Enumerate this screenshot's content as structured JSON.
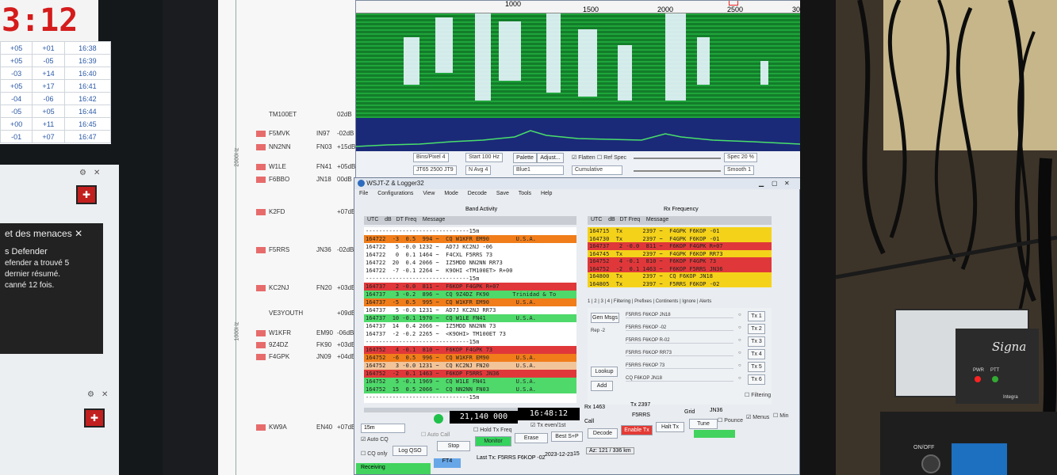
{
  "left_screen": {
    "clock": "3:12",
    "table": [
      [
        "+05",
        "+01",
        "16:38"
      ],
      [
        "+05",
        "-05",
        "16:39"
      ],
      [
        "-03",
        "+14",
        "16:40"
      ],
      [
        "+05",
        "+17",
        "16:41"
      ],
      [
        "-04",
        "-06",
        "16:42"
      ],
      [
        "-05",
        "+05",
        "16:44"
      ],
      [
        "+00",
        "+11",
        "16:45"
      ],
      [
        "-01",
        "+07",
        "16:47"
      ]
    ],
    "toast_title": "et des menaces",
    "toast_close": "✕",
    "toast_app": "s Defender",
    "toast_line1": "efender a trouvé 5",
    "toast_line2": "dernier résumé.",
    "toast_line3": "canné 12 fois."
  },
  "spots": [
    {
      "call": "TM100ET",
      "loc": "",
      "rpt": "02dB",
      "box": false
    },
    {
      "call": "F5MVK",
      "loc": "IN97",
      "rpt": "-02dB",
      "box": true
    },
    {
      "call": "NN2NN",
      "loc": "FN03",
      "rpt": "+15dB",
      "box": true
    },
    {
      "call": "W1LE",
      "loc": "FN41",
      "rpt": "+05dB",
      "box": true
    },
    {
      "call": "F6BBO",
      "loc": "JN18",
      "rpt": "00dB",
      "box": true
    },
    {
      "call": "K2FD",
      "loc": "",
      "rpt": "+07dB",
      "box": true
    },
    {
      "call": "F5RRS",
      "loc": "JN36",
      "rpt": "-02dB",
      "box": true
    },
    {
      "call": "KC2NJ",
      "loc": "FN20",
      "rpt": "+03dB",
      "box": true
    },
    {
      "call": "VE3YOUTH",
      "loc": "",
      "rpt": "+09dB",
      "box": false
    },
    {
      "call": "W1KFR",
      "loc": "EM90",
      "rpt": "-06dB",
      "box": true
    },
    {
      "call": "9Z4DZ",
      "loc": "FK90",
      "rpt": "+03dB",
      "box": true
    },
    {
      "call": "F4GPK",
      "loc": "JN09",
      "rpt": "+04dB",
      "box": true
    },
    {
      "call": "KW9A",
      "loc": "EN40",
      "rpt": "+07dB",
      "box": true
    }
  ],
  "axis_labels": {
    "hz2000": "2000Hz",
    "hz1000": "1000Hz"
  },
  "waterfall": {
    "scale": [
      "1000",
      "1500",
      "2000",
      "2500",
      "3000"
    ],
    "bins_pixel": "Bins/Pixel  4",
    "start": "Start 100 Hz",
    "palette": "Palette",
    "adjust": "Adjust...",
    "flatten": "Flatten",
    "ref_spec": "Ref Spec",
    "jt65": "JT65  2500  JT9",
    "navg": "N Avg  4",
    "blue": "Blue1",
    "cumulative": "Cumulative",
    "spec": "Spec  20 %",
    "smooth": "Smooth  1"
  },
  "main": {
    "title": "WSJT-Z & Logger32",
    "menu": [
      "File",
      "Configurations",
      "View",
      "Mode",
      "Decode",
      "Save",
      "Tools",
      "Help"
    ],
    "band_activity": "Band Activity",
    "rx_frequency": "Rx Frequency",
    "hdr_left": "UTC    dB   DT Freq    Message",
    "hdr_right": "UTC    dB   DT Freq    Message",
    "band_rows": [
      {
        "t": "-------------------------------15m",
        "c": "#ffffff"
      },
      {
        "t": "164722  -3  0.5  994 ~  CQ W1KFR EM90        U.S.A.",
        "c": "#f07d1a"
      },
      {
        "t": "164722   5 -0.0 1232 ~  AD7J KC2NJ -06",
        "c": "#ffffff"
      },
      {
        "t": "164722   0  0.1 1464 ~  F4CXL F5RRS 73",
        "c": "#ffffff"
      },
      {
        "t": "164722  20  0.4 2066 ~  IZ5MDD NN2NN RR73",
        "c": "#ffffff"
      },
      {
        "t": "164722  -7 -0.1 2264 ~  K9OHI <TM100ET> R+00",
        "c": "#ffffff"
      },
      {
        "t": "-------------------------------15m",
        "c": "#ffffff"
      },
      {
        "t": "164737   2 -0.0  811 ~  F6KOP F4GPK R+07",
        "c": "#e0383a"
      },
      {
        "t": "164737   3 -0.2  896 ~  CQ 9Z4DZ FK90       Trinidad & To",
        "c": "#4ed96a"
      },
      {
        "t": "164737  -5  0.5  995 ~  CQ W1KFR EM90        U.S.A.",
        "c": "#f07d1a"
      },
      {
        "t": "164737   5 -0.0 1231 ~  AD7J KC2NJ RR73",
        "c": "#ffffff"
      },
      {
        "t": "164737  10 -0.1 1970 ~  CQ W1LE FN41         U.S.A.",
        "c": "#4ed96a"
      },
      {
        "t": "164737  14  0.4 2066 ~  IZ5MDD NN2NN 73",
        "c": "#ffffff"
      },
      {
        "t": "164737  -2 -0.2 2265 ~  <K9OHI> TM100ET 73",
        "c": "#ffffff"
      },
      {
        "t": "-------------------------------15m",
        "c": "#ffffff"
      },
      {
        "t": "164752   4 -0.1  810 ~  F6KOP F4GPK 73",
        "c": "#e0383a"
      },
      {
        "t": "164752  -6  0.5  996 ~  CQ W1KFR EM90        U.S.A.",
        "c": "#f07d1a"
      },
      {
        "t": "164752   3 -0.0 1231 ~  CQ KC2NJ FN20        U.S.A.",
        "c": "#f2c49a"
      },
      {
        "t": "164752  -2  0.1 1463 ~  F6KOP F5RRS JN36",
        "c": "#e0383a"
      },
      {
        "t": "164752   5 -0.1 1969 ~  CQ W1LE FN41         U.S.A.",
        "c": "#4ed96a"
      },
      {
        "t": "164752  15  0.5 2066 ~  CQ NN2NN FN03        U.S.A.",
        "c": "#4ed96a"
      },
      {
        "t": "-------------------------------15m",
        "c": "#ffffff"
      }
    ],
    "rx_rows": [
      {
        "t": "164715  Tx      2397 ~  F4GPK F6KOP -01",
        "c": "#f5d21a"
      },
      {
        "t": "164730  Tx      2397 ~  F4GPK F6KOP -01",
        "c": "#f5d21a"
      },
      {
        "t": "164737   2 -0.0  811 ~  F6KOP F4GPK R+07",
        "c": "#e0383a"
      },
      {
        "t": "164745  Tx      2397 ~  F4GPK F6KOP RR73",
        "c": "#f5d21a"
      },
      {
        "t": "164752   4 -0.1  810 ~  F6KOP F4GPK 73",
        "c": "#e0383a"
      },
      {
        "t": "164752  -2  0.1 1463 ~  F6KOP F5RRS JN36",
        "c": "#e0383a"
      },
      {
        "t": "164800  Tx      2397 ~  CQ F6KOP JN18",
        "c": "#f5d21a"
      },
      {
        "t": "164805  Tx      2397 ~  F5RRS F6KOP -02",
        "c": "#f5d21a"
      }
    ],
    "tabs": "1 | 2 | 3 | 4 | Filtering | Prefixes | Continents | Ignore | Alerts",
    "gen_msgs": "Gen Msgs",
    "rep": "Rep -2",
    "lookup": "Lookup",
    "add": "Add",
    "tx_msgs": [
      "F5RRS F6KOP JN18",
      "F5RRS F6KOP -02",
      "F5RRS F6KOP R-02",
      "F5RRS F6KOP RR73",
      "F5RRS F6KOP 73",
      "CQ F6KOP JN18"
    ],
    "tx_btns": [
      "Tx 1",
      "Tx 2",
      "Tx 3",
      "Tx 4",
      "Tx 5",
      "Tx 6"
    ],
    "band": "15m",
    "frequency": "21,140 000",
    "time": "16:48:12",
    "hold_tx": "Hold Tx Freq",
    "tx_even": "Tx even/1st",
    "auto_cq": "Auto CQ",
    "auto_call": "Auto Call",
    "cq_only": "CQ only",
    "log_qso": "Log QSO",
    "stop": "Stop",
    "monitor": "Monitor",
    "erase": "Erase",
    "best_s": "Best S+P",
    "decode": "Decode",
    "enable_tx": "Enable Tx",
    "halt_tx": "Halt Tx",
    "tune": "Tune",
    "receiving": "Receiving",
    "mode": "FT4",
    "last_tx": "Last Tx: F5RRS F6KOP -02",
    "date": "2023-12-23",
    "tr": "15",
    "az": "Az: 121 / 336 km",
    "rx_hz": "Rx 1463",
    "tx_hz": "Tx 2397",
    "call": "Call",
    "grid": "Grid",
    "f5rrs": "F5RRS",
    "jn36": "JN36",
    "pounce": "Pounce",
    "menus": "Menus",
    "min": "Min",
    "filtering": "Filtering"
  },
  "hardware": {
    "signa": "Signa",
    "pwr": "PWR",
    "ptt": "PTT",
    "integra": "Integra",
    "onoff": "ON/OFF"
  }
}
